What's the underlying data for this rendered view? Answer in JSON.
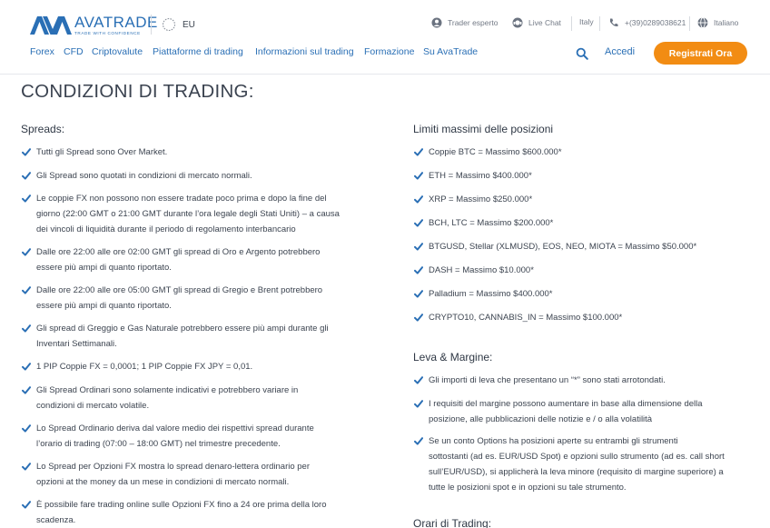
{
  "header": {
    "brand": "AVATRADE",
    "tagline": "TRADE WITH CONFIDENCE",
    "region": "EU",
    "utility": {
      "account": "Trader esperto",
      "chat": "Live Chat",
      "country": "Italy",
      "phone": "+(39)0289038621",
      "language": "Italiano"
    },
    "nav": [
      "Forex",
      "CFD",
      "Criptovalute",
      "Piattaforme di trading",
      "Informazioni sul trading",
      "Formazione",
      "Su AvaTrade"
    ],
    "login": "Accedi",
    "register": "Registrati Ora",
    "colors": {
      "brand": "#2a6fb5",
      "cta": "#f28c13",
      "check": "#2a6fb5"
    },
    "icons": [
      "logo-icon",
      "globe-icon",
      "user-icon",
      "headset-icon",
      "phone-icon",
      "globe-icon",
      "search-icon",
      "check-icon"
    ]
  },
  "page": {
    "title": "CONDIZIONI DI TRADING:",
    "spreads": {
      "title": "Spreads:",
      "items": [
        "Tutti gli Spread sono Over Market.",
        "Gli Spread sono quotati in condizioni di mercato normali.",
        [
          "Le coppie FX non possono non essere tradate poco prima e dopo la fine del",
          "giorno (22:00 GMT o 21:00 GMT durante l’ora legale degli Stati Uniti) – a causa",
          "dei vincoli di liquidità durante il periodo di regolamento interbancario"
        ],
        [
          "Dalle ore 22:00 alle ore 02:00 GMT gli spread di Oro e Argento potrebbero",
          "essere più ampi di quanto riportato."
        ],
        [
          "Dalle ore 22:00 alle ore 05:00 GMT gli spread di Gregio e Brent potrebbero",
          "essere più ampi di quanto riportato."
        ],
        [
          "Gli spread di Greggio e Gas Naturale potrebbero essere più ampi durante gli",
          "Inventari Settimanali."
        ],
        "1 PIP Coppie FX = 0,0001; 1 PIP Coppie FX JPY = 0,01.",
        [
          "Gli Spread Ordinari sono solamente indicativi e potrebbero variare in",
          "condizioni di mercato volatile."
        ],
        [
          "Lo Spread Ordinario deriva dal valore medio dei rispettivi spread durante",
          "l’orario di trading (07:00 – 18:00 GMT) nel trimestre precedente."
        ],
        [
          "Lo Spread per Opzioni FX mostra lo spread denaro-lettera ordinario per",
          "opzioni at the money da un mese in condizioni di mercato normali."
        ],
        [
          "È possibile fare trading online sulle Opzioni FX fino a 24 ore prima della loro",
          "scadenza."
        ]
      ]
    },
    "limits": {
      "title": "Limiti massimi delle posizioni",
      "items": [
        "Coppie BTC = Massimo $600.000*",
        "ETH = Massimo $400.000*",
        "XRP = Massimo $250.000*",
        "BCH, LTC = Massimo $200.000*",
        "BTGUSD, Stellar (XLMUSD), EOS, NEO, MIOTA = Massimo $50.000*",
        "DASH = Massimo $10.000*",
        "Palladium = Massimo $400.000*",
        "CRYPTO10, CANNABIS_IN = Massimo $100.000*"
      ]
    },
    "leverage": {
      "title": "Leva & Margine:",
      "items": [
        "Gli importi di leva che presentano un “*” sono stati arrotondati.",
        [
          "I requisiti del margine possono aumentare in base alla dimensione della",
          "posizione, alle pubblicazioni delle notizie e / o alla volatilità"
        ],
        [
          "Se un conto Options ha posizioni aperte su entrambi gli strumenti",
          "sottostanti (ad es. EUR/USD Spot) e opzioni sullo strumento (ad es. call short",
          "sull’EUR/USD), si applicherà la leva minore (requisito di margine superiore) a",
          "tutte le posizioni spot e in opzioni su tale strumento."
        ]
      ]
    },
    "hours": {
      "title": "Orari di Trading:"
    }
  }
}
